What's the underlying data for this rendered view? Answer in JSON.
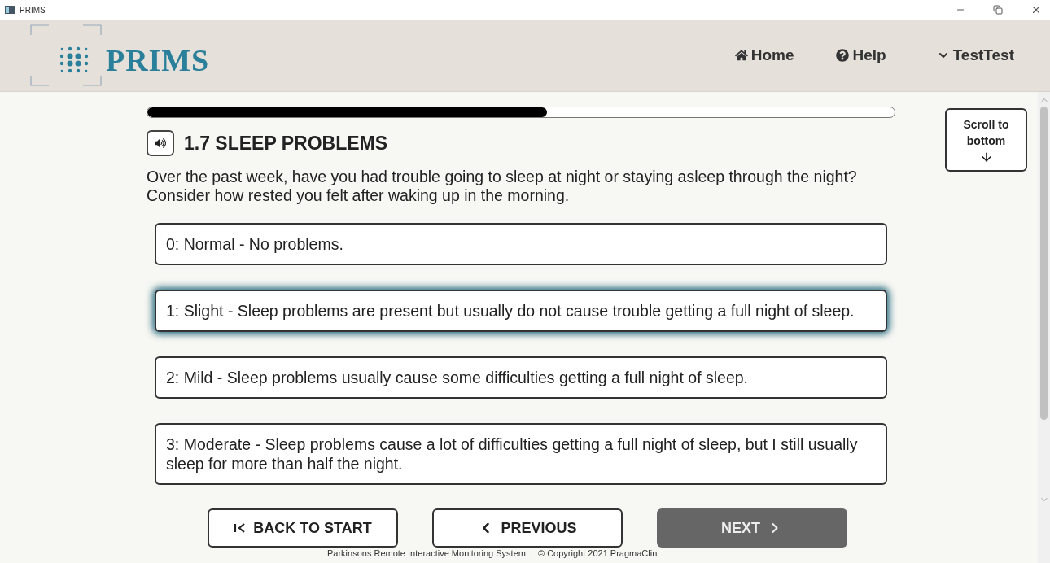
{
  "window": {
    "title": "PRIMS"
  },
  "header": {
    "logo_text": "PRIMS",
    "nav": [
      {
        "kind": "home",
        "label": "Home"
      },
      {
        "kind": "help",
        "label": "Help"
      },
      {
        "kind": "user",
        "label": "TestTest"
      }
    ]
  },
  "progress": {
    "level": 0.535
  },
  "question": {
    "title": "1.7 SLEEP PROBLEMS",
    "text": "Over the past week, have you had trouble going to sleep at night or staying asleep through the night? Consider how rested you felt after waking up in the morning."
  },
  "options": [
    {
      "label": "0: Normal - No problems.",
      "selected": false
    },
    {
      "label": "1: Slight - Sleep problems are present but usually do not cause trouble getting a full night of sleep.",
      "selected": true
    },
    {
      "label": "2: Mild - Sleep problems usually cause some difficulties getting a full night of sleep.",
      "selected": false
    },
    {
      "label": "3: Moderate - Sleep problems cause a lot of difficulties getting a full night of sleep, but I still usually sleep for more than half the night.",
      "selected": false
    }
  ],
  "scroll_button": {
    "label": "Scroll to bottom"
  },
  "buttons": [
    {
      "kind": "start",
      "label": "BACK TO START",
      "disabled": false
    },
    {
      "kind": "previous",
      "label": "PREVIOUS",
      "disabled": false
    },
    {
      "kind": "next",
      "label": "NEXT",
      "disabled": true
    }
  ],
  "footer": "Parkinsons Remote Interactive Monitoring System  |  © Copyright 2021 PragmaClin"
}
